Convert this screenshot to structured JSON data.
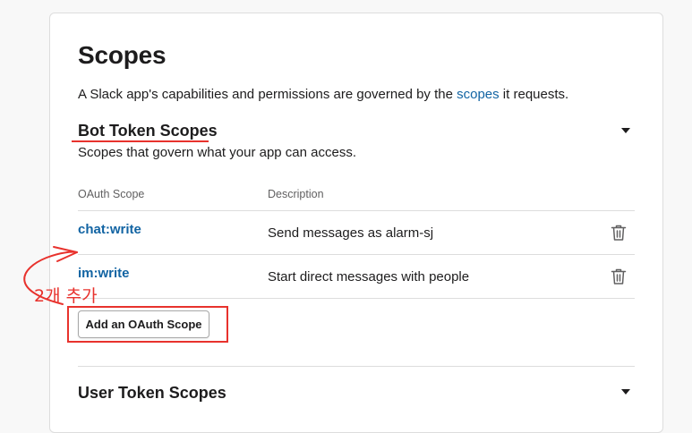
{
  "page": {
    "title": "Scopes",
    "intro_before": "A Slack app's capabilities and permissions are governed by the ",
    "intro_link": "scopes",
    "intro_after": " it requests."
  },
  "bot_section": {
    "title": "Bot Token Scopes",
    "subtitle": "Scopes that govern what your app can access.",
    "col_scope": "OAuth Scope",
    "col_desc": "Description",
    "rows": [
      {
        "scope": "chat:write",
        "desc": "Send messages as alarm-sj"
      },
      {
        "scope": "im:write",
        "desc": "Start direct messages with people"
      }
    ],
    "add_button": "Add an OAuth Scope"
  },
  "user_section": {
    "title": "User Token Scopes"
  },
  "annotation": {
    "text": "2개 추가",
    "color": "#e8322d"
  },
  "colors": {
    "link": "#1264a3",
    "text": "#1d1c1d",
    "muted": "#616061"
  }
}
